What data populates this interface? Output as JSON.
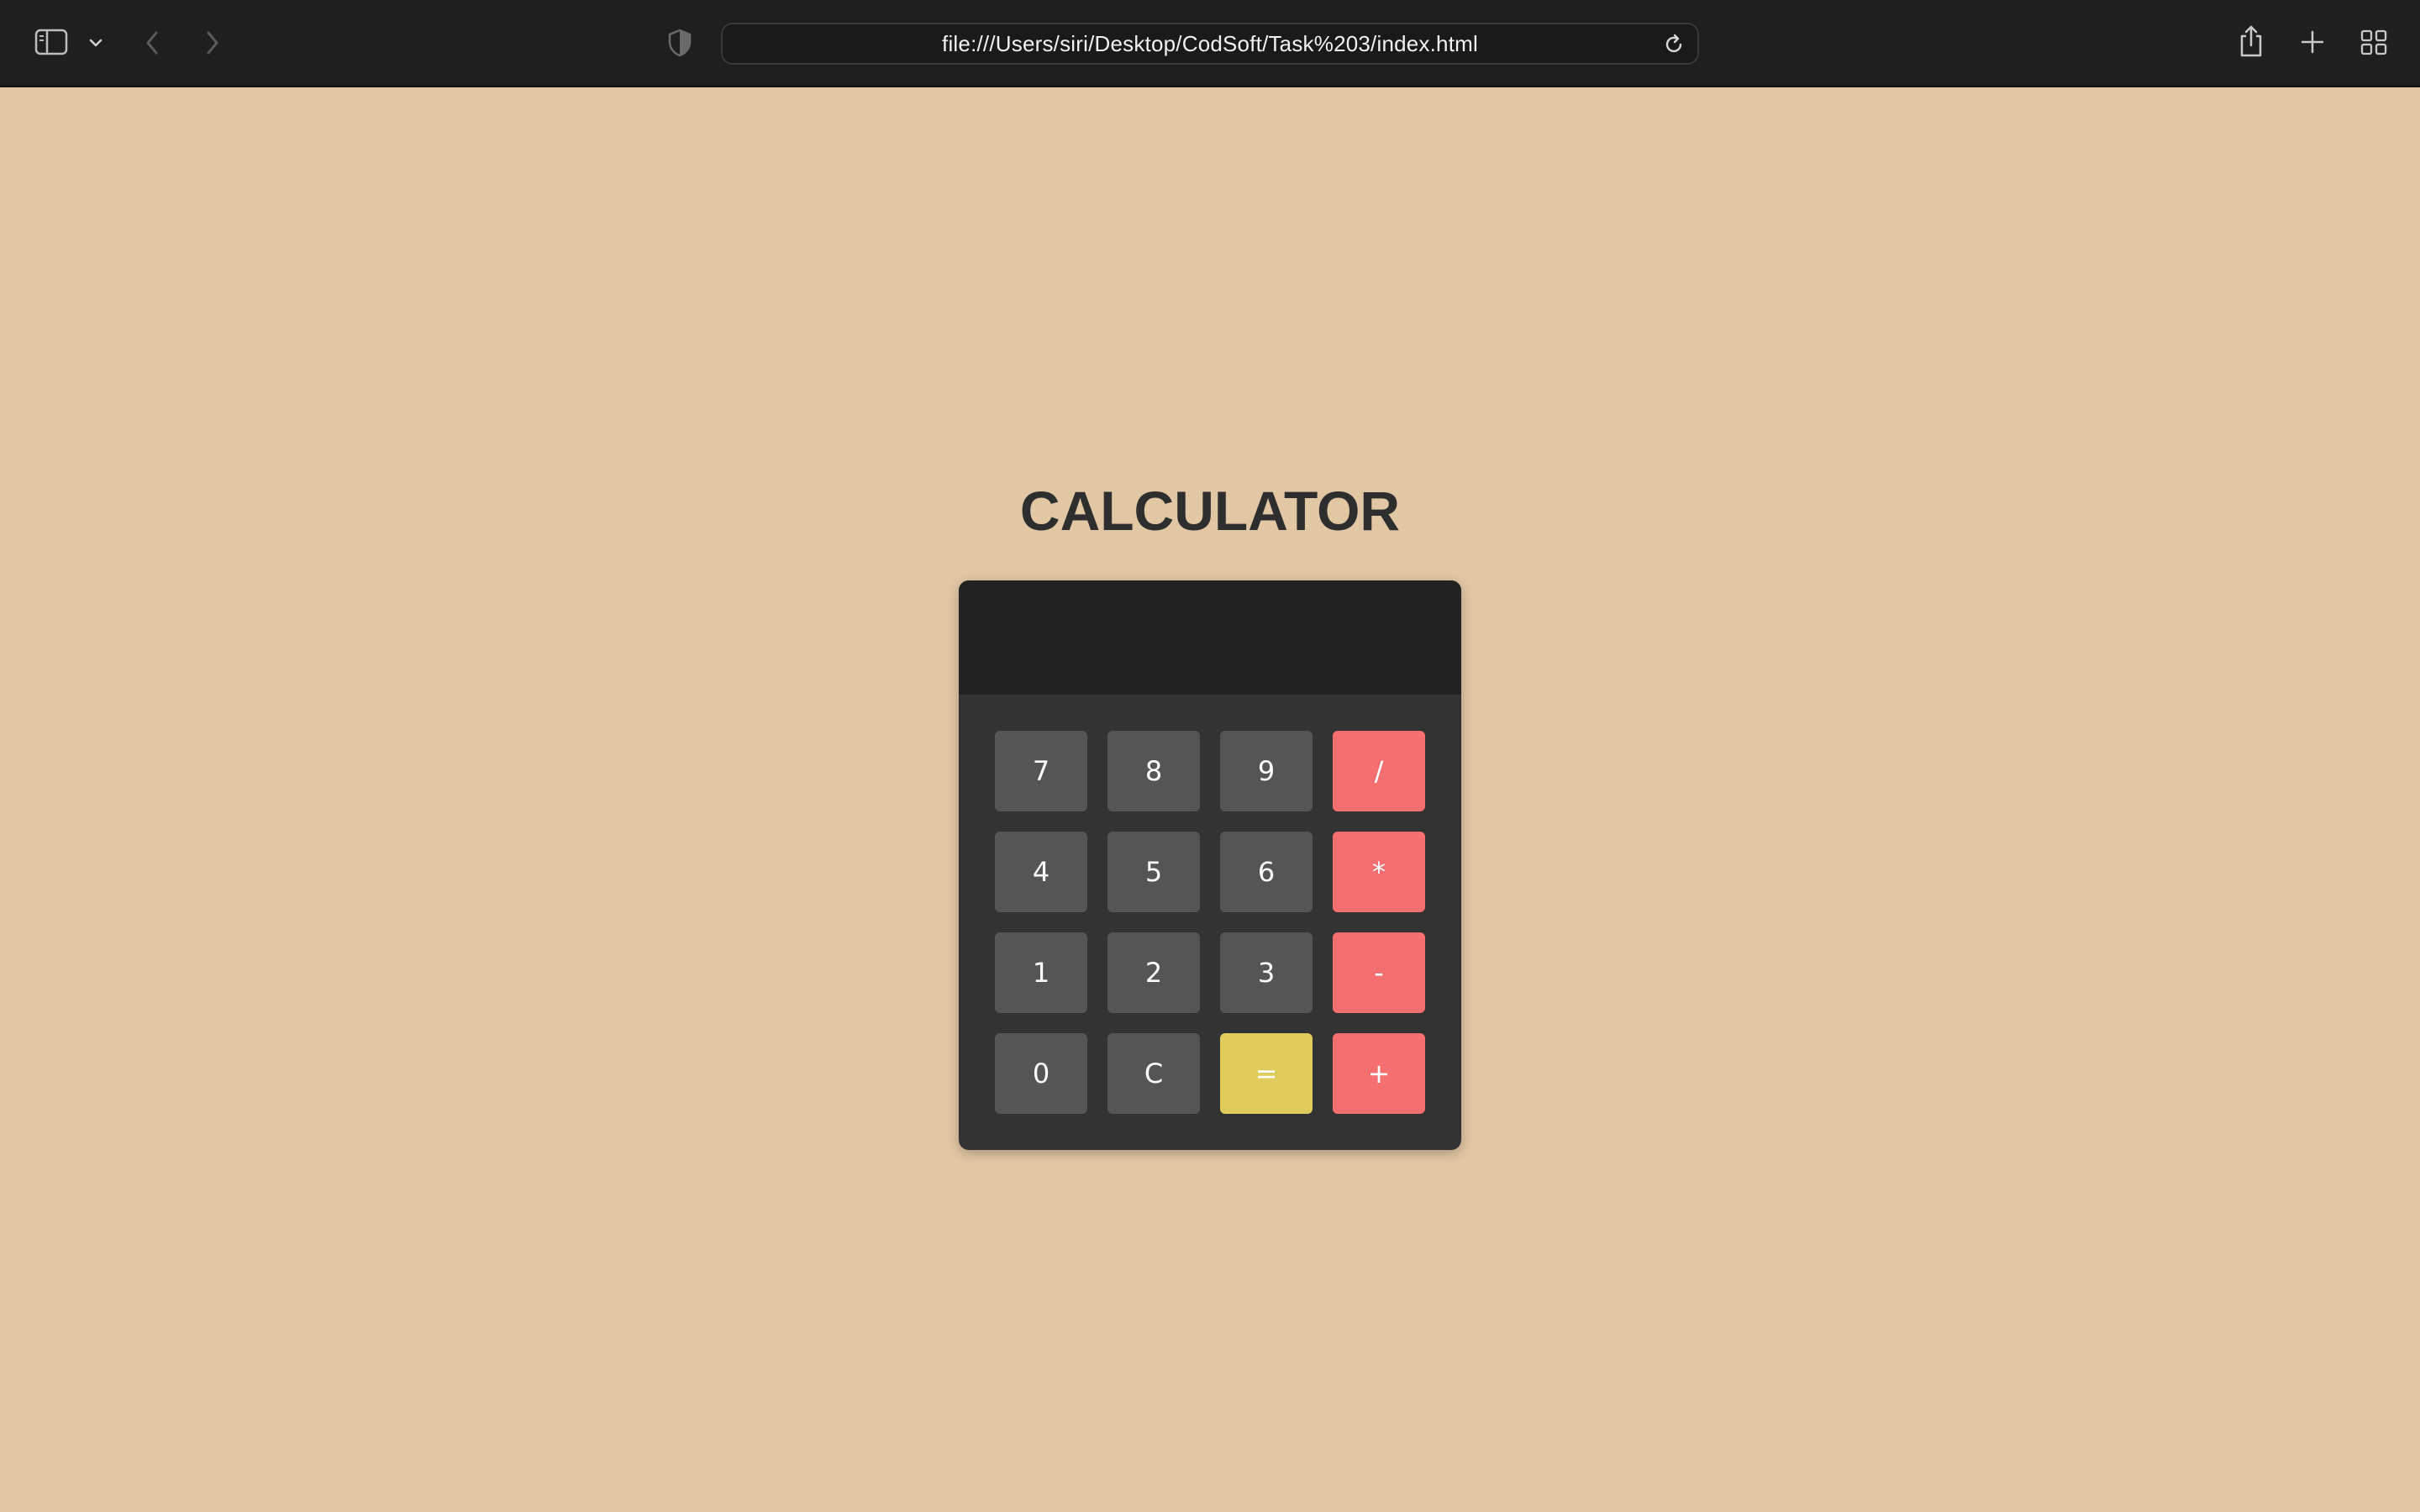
{
  "browser": {
    "url": "file:///Users/siri/Desktop/CodSoft/Task%203/index.html",
    "icons": [
      "sidebar-icon",
      "chevron-down-icon",
      "back-icon",
      "forward-icon",
      "shield-icon",
      "reload-icon",
      "share-icon",
      "plus-icon",
      "tab-overview-icon"
    ]
  },
  "page": {
    "title": "CALCULATOR"
  },
  "calculator": {
    "display_value": "",
    "keys": [
      {
        "label": "7",
        "kind": "digit"
      },
      {
        "label": "8",
        "kind": "digit"
      },
      {
        "label": "9",
        "kind": "digit"
      },
      {
        "label": "/",
        "kind": "operator"
      },
      {
        "label": "4",
        "kind": "digit"
      },
      {
        "label": "5",
        "kind": "digit"
      },
      {
        "label": "6",
        "kind": "digit"
      },
      {
        "label": "*",
        "kind": "operator"
      },
      {
        "label": "1",
        "kind": "digit"
      },
      {
        "label": "2",
        "kind": "digit"
      },
      {
        "label": "3",
        "kind": "digit"
      },
      {
        "label": "-",
        "kind": "operator"
      },
      {
        "label": "0",
        "kind": "digit"
      },
      {
        "label": "C",
        "kind": "clear"
      },
      {
        "label": "=",
        "kind": "equals"
      },
      {
        "label": "+",
        "kind": "operator"
      }
    ]
  },
  "colors": {
    "page_background": "#e2c7a5",
    "toolbar_background": "#1f1f1f",
    "calculator_body": "#333333",
    "display_background": "#222222",
    "digit_key": "#555555",
    "operator_key": "#f56f71",
    "equals_key": "#e0cc5c",
    "title_text": "#2e2e2e"
  }
}
